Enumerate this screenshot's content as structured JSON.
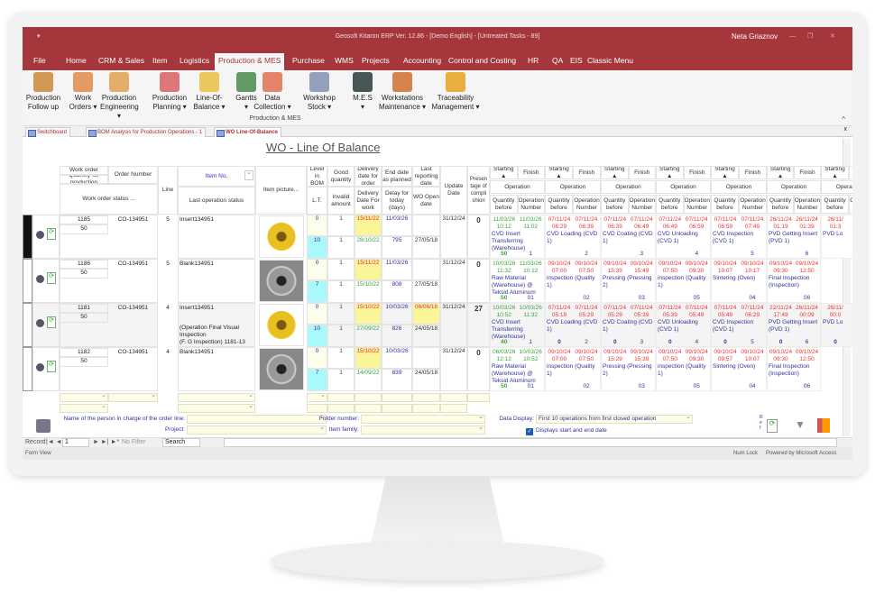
{
  "window": {
    "title": "Geosoft Kitaron ERP Ver. 12.86 - [Demo English] - [Untreated Tasks - 89]",
    "user": "Neta Griaznov",
    "quick_access": "▾"
  },
  "menu": {
    "tabs": [
      "File",
      "Home",
      "CRM & Sales",
      "Item",
      "Logistics",
      "Production & MES",
      "Purchase",
      "WMS",
      "Projects",
      "Accounting",
      "Control and Costing",
      "HR",
      "QA",
      "EIS",
      "Classic Menu"
    ],
    "active": "Production & MES"
  },
  "ribbon": {
    "group_label": "Production & MES",
    "buttons": [
      {
        "label": "Production\nFollow up",
        "icon": "worker-icon",
        "color": "#c98a3a"
      },
      {
        "label": "Work\nOrders ▾",
        "icon": "clipboard-icon",
        "color": "#e08a4a"
      },
      {
        "label": "Production\nEngineering ▾",
        "icon": "engineering-icon",
        "color": "#e0a050"
      },
      {
        "label": "Production\nPlanning ▾",
        "icon": "planning-chart-icon",
        "color": "#d86060"
      },
      {
        "label": "Line-Of-\nBalance ▾",
        "icon": "clock-chart-icon",
        "color": "#e8c040"
      },
      {
        "label": "Gantts\n▾",
        "icon": "jit-gantt-icon",
        "color": "#4a8a4a"
      },
      {
        "label": "Data\nCollection ▾",
        "icon": "data-collection-icon",
        "color": "#e07050"
      },
      {
        "label": "Workshop\nStock ▾",
        "icon": "gears-icon",
        "color": "#8090b0"
      },
      {
        "label": "M.E.S\n▾",
        "icon": "monitor-icon",
        "color": "#2a3a3a"
      },
      {
        "label": "Workstations\nMaintenance ▾",
        "icon": "tools-icon",
        "color": "#d07030"
      },
      {
        "label": "Traceability\nManagement ▾",
        "icon": "hierarchy-icon",
        "color": "#e8a020"
      }
    ]
  },
  "doc_tabs": [
    "Switchboard",
    "BOM Analysis for Production Operations - 1",
    "WO Line-Of-Balance"
  ],
  "form": {
    "title": "WO - Line Of Balance"
  },
  "headers": {
    "work_order": "Work order",
    "qty_production": "Quantity for production",
    "order_number": "Order Number",
    "wo_status": "Work order status ...",
    "line": "Line",
    "item_no": "Item No.",
    "last_op_status": "Last operation status",
    "item_picture": "Item picture...",
    "level": "Level in BOM",
    "lt": "L.T.",
    "good": "Good quantity",
    "invalid": "Invalid amount",
    "delivery_order": "Delivery date for order",
    "delivery_work": "Delivery Date For work",
    "end_date": "End date as planned",
    "delay": "Delay for today (days)",
    "last_report": "Last reporting date",
    "wo_open": "WO Open date",
    "update": "Update Date",
    "percent": "Presen tage of compli shion",
    "starting": "Starting ▲",
    "finish": "Finish",
    "operation": "Operation",
    "qty_before": "Quantity before",
    "op_number": "Operation Number"
  },
  "rows": [
    {
      "wo": "1185",
      "qty": "50",
      "order": "CO-134951",
      "line": "5",
      "item": "Insert134951",
      "last_op": "",
      "image": "gold",
      "level": "0",
      "lt": "10",
      "good": "1",
      "invalid": "1",
      "delivery_order": "15/11/22",
      "delivery_work": "28/10/22",
      "end_date": "11/03/26",
      "delay": "795",
      "last_report": "",
      "wo_open": "27/05/18",
      "update": "31/12/24",
      "percent": "0",
      "ops": [
        {
          "s": "11/03/26\n10:12",
          "f": "11/03/26\n11:02",
          "name": "CVD  Insert Transferring (Warehouse)",
          "qty": "50",
          "num": "1",
          "status": "done"
        },
        {
          "s": "07/11/24\n06:29",
          "f": "07/11/24\n06:39",
          "name": "CVD Loading (CVD 1)",
          "qty": "",
          "num": "2",
          "status": "late"
        },
        {
          "s": "07/11/24\n06:39",
          "f": "07/11/24\n06:49",
          "name": "CVD Coating (CVD 1)",
          "qty": "",
          "num": "3",
          "status": "late"
        },
        {
          "s": "07/11/24\n06:49",
          "f": "07/11/24\n06:59",
          "name": "CVD Unloading (CVD 1)",
          "qty": "",
          "num": "4",
          "status": "late"
        },
        {
          "s": "07/11/24\n06:59",
          "f": "07/11/24\n07:49",
          "name": "CVD Inspection (CVD 1)",
          "qty": "",
          "num": "5",
          "status": "late"
        },
        {
          "s": "26/11/24\n01:19",
          "f": "26/11/24\n01:39",
          "name": "PVD Getting Insert (PVD 1)",
          "qty": "",
          "num": "6",
          "status": "late"
        },
        {
          "s": "26/11/\n01:3",
          "f": "",
          "name": "PVD Lo",
          "qty": "",
          "num": "",
          "status": "late"
        }
      ]
    },
    {
      "wo": "1186",
      "qty": "50",
      "order": "CO-134951",
      "line": "5",
      "item": "Blank134951",
      "last_op": "",
      "image": "gray",
      "level": "0",
      "lt": "7",
      "good": "1",
      "invalid": "1",
      "delivery_order": "15/11/22",
      "delivery_work": "15/10/22",
      "end_date": "11/03/26",
      "delay": "808",
      "last_report": "",
      "wo_open": "27/05/18",
      "update": "31/12/24",
      "percent": "0",
      "ops": [
        {
          "s": "10/03/26\n11:32",
          "f": "11/03/26\n10:12",
          "name": "Raw Material (Warehouse) @ Teksid Aluminum",
          "qty": "50",
          "num": "01",
          "status": "done"
        },
        {
          "s": "09/10/24\n07:00",
          "f": "09/10/24\n07:50",
          "name": "inspection (Quality 1)",
          "qty": "",
          "num": "02",
          "status": "late"
        },
        {
          "s": "09/10/24\n15:39",
          "f": "09/10/24\n15:49",
          "name": "Pressing (Pressing 2)",
          "qty": "",
          "num": "03",
          "status": "late"
        },
        {
          "s": "09/10/24\n07:50",
          "f": "09/10/24\n09:30",
          "name": "inspection (Quality 1)",
          "qty": "",
          "num": "05",
          "status": "late"
        },
        {
          "s": "09/10/24\n10:07",
          "f": "09/10/24\n10:17",
          "name": "Sintering (Oven)",
          "qty": "",
          "num": "04",
          "status": "late"
        },
        {
          "s": "09/10/24\n09:30",
          "f": "09/10/24\n12:50",
          "name": "Final Inspection (Inspection)",
          "qty": "",
          "num": "06",
          "status": "late"
        }
      ]
    },
    {
      "wo": "1181",
      "qty": "50",
      "order": "CO-134951",
      "line": "4",
      "item": "Insert134951",
      "last_op": "(Operation Final Visual Inspection\n(F. G Inspection) 1181-13",
      "image": "gold",
      "level": "0",
      "lt": "10",
      "good": "1",
      "invalid": "1",
      "delivery_order": "15/10/22",
      "delivery_work": "27/09/22",
      "end_date": "10/03/26",
      "delay": "826",
      "last_report": "06/06/18",
      "wo_open": "24/05/18",
      "update": "31/12/24",
      "percent": "27",
      "ops": [
        {
          "s": "10/03/26\n10:52",
          "f": "10/03/26\n11:32",
          "name": "CVD  Insert Transferring (Warehouse)",
          "qty": "40",
          "num": "1",
          "status": "done"
        },
        {
          "s": "07/11/24\n05:19",
          "f": "07/11/24\n05:29",
          "name": "CVD Loading (CVD 1)",
          "qty": "0",
          "num": "2",
          "status": "late"
        },
        {
          "s": "07/11/24\n05:29",
          "f": "07/11/24\n05:39",
          "name": "CVD Coating (CVD 1)",
          "qty": "0",
          "num": "3",
          "status": "late"
        },
        {
          "s": "07/11/24\n05:39",
          "f": "07/11/24\n05:49",
          "name": "CVD Unloading (CVD 1)",
          "qty": "0",
          "num": "4",
          "status": "late"
        },
        {
          "s": "07/11/24\n05:49",
          "f": "07/11/24\n06:29",
          "name": "CVD Inspection (CVD 1)",
          "qty": "0",
          "num": "5",
          "status": "late"
        },
        {
          "s": "22/11/24\n17:49",
          "f": "26/11/24\n00:09",
          "name": "PVD Getting Insert (PVD 1)",
          "qty": "0",
          "num": "6",
          "status": "late"
        },
        {
          "s": "26/11/\n00:0",
          "f": "",
          "name": "PVD Lo",
          "qty": "0",
          "num": "",
          "status": "late"
        }
      ]
    },
    {
      "wo": "1182",
      "qty": "50",
      "order": "CO-134951",
      "line": "4",
      "item": "Blank134951",
      "last_op": "",
      "image": "gray",
      "level": "0",
      "lt": "7",
      "good": "1",
      "invalid": "1",
      "delivery_order": "15/10/22",
      "delivery_work": "14/09/22",
      "end_date": "10/03/26",
      "delay": "839",
      "last_report": "",
      "wo_open": "24/05/18",
      "update": "31/12/24",
      "percent": "0",
      "ops": [
        {
          "s": "06/03/26\n12:12",
          "f": "10/03/26\n10:52",
          "name": "Raw Material (Warehouse) @ Teksid Aluminum",
          "qty": "50",
          "num": "01",
          "status": "done"
        },
        {
          "s": "09/10/24\n07:00",
          "f": "09/10/24\n07:50",
          "name": "inspection (Quality 1)",
          "qty": "",
          "num": "02",
          "status": "late"
        },
        {
          "s": "09/10/24\n15:29",
          "f": "09/10/24\n15:39",
          "name": "Pressing (Pressing 2)",
          "qty": "",
          "num": "03",
          "status": "late"
        },
        {
          "s": "09/10/24\n07:50",
          "f": "09/10/24\n09:30",
          "name": "inspection (Quality 1)",
          "qty": "",
          "num": "05",
          "status": "late"
        },
        {
          "s": "09/10/24\n09:57",
          "f": "09/10/24\n10:07",
          "name": "Sintering (Oven)",
          "qty": "",
          "num": "04",
          "status": "late"
        },
        {
          "s": "09/10/24\n09:30",
          "f": "09/10/24\n12:50",
          "name": "Final Inspection (Inspection)",
          "qty": "",
          "num": "06",
          "status": "late"
        }
      ]
    }
  ],
  "bottom": {
    "person_label": "Name of the person in charge of the order line:",
    "project_label": "Project:",
    "folder_label": "Folder number:",
    "item_family_label": "Item family:",
    "data_display_label": "Data Display:",
    "data_display_value": "First 10 operations from first closed operation",
    "checkbox_label": "Displays start and end date",
    "checkbox_checked": true,
    "refresh_label": "R\ne\nf"
  },
  "record_nav": {
    "label": "Record:",
    "value": "1",
    "no_filter": "No Filter",
    "search": "Search"
  },
  "status": {
    "left": "Form View",
    "num_lock": "Num Lock",
    "powered": "Powered by Microsoft Access"
  },
  "colors": {
    "brand": "#a4363c",
    "done": "#3aa53a",
    "late": "#e33333",
    "op_name": "#33339a",
    "yellow": "#fbf59a",
    "cyan": "#a8f8fc"
  }
}
